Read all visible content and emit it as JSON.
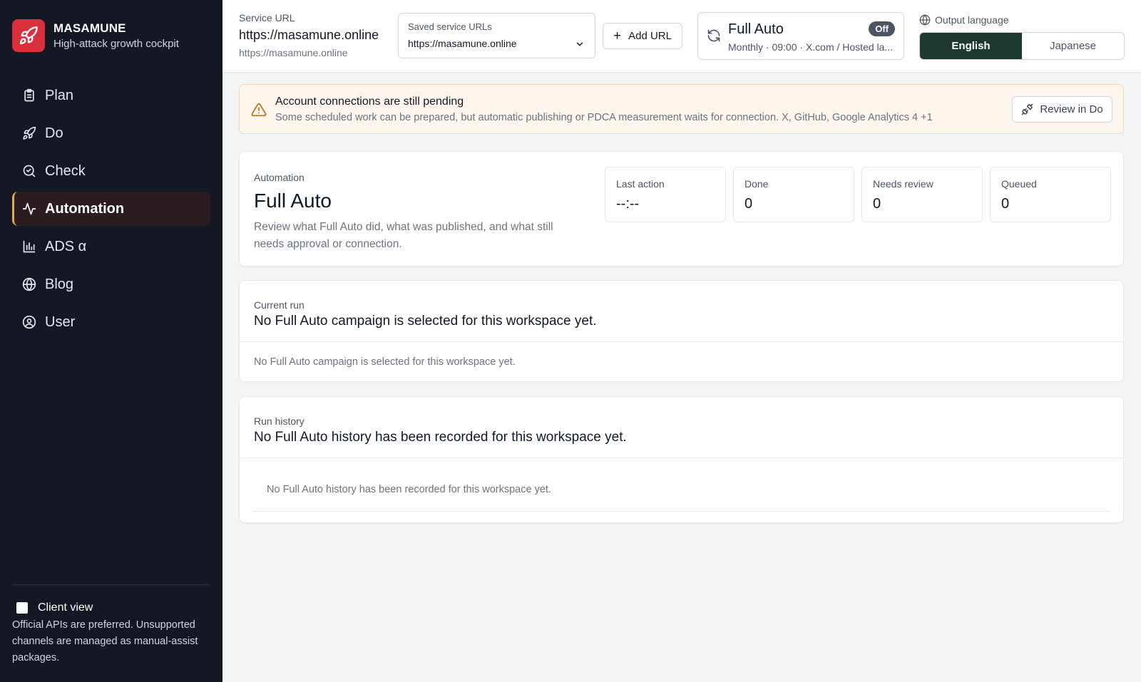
{
  "brand": {
    "name": "MASAMUNE",
    "tagline": "High-attack growth cockpit"
  },
  "nav": [
    {
      "label": "Plan",
      "icon": "clipboard-icon",
      "active": false
    },
    {
      "label": "Do",
      "icon": "rocket-icon",
      "active": false
    },
    {
      "label": "Check",
      "icon": "search-check-icon",
      "active": false
    },
    {
      "label": "Automation",
      "icon": "activity-icon",
      "active": true
    },
    {
      "label": "ADS α",
      "icon": "bar-chart-icon",
      "active": false
    },
    {
      "label": "Blog",
      "icon": "globe-icon",
      "active": false
    },
    {
      "label": "User",
      "icon": "user-circle-icon",
      "active": false
    }
  ],
  "sidebar_footer": {
    "client_view_label": "Client view",
    "client_view_checked": false,
    "note": "Official APIs are preferred. Unsupported channels are managed as manual-assist packages."
  },
  "header": {
    "service_url_label": "Service URL",
    "service_url_value": "https://masamune.online",
    "service_url_sub": "https://masamune.online",
    "saved_label": "Saved service URLs",
    "saved_value": "https://masamune.online",
    "add_url_label": "Add URL",
    "full_auto": {
      "title": "Full Auto",
      "badge": "Off",
      "subtitle": "Monthly · 09:00 · X.com / Hosted la..."
    },
    "language": {
      "label": "Output language",
      "options": [
        "English",
        "Japanese"
      ],
      "selected": "English"
    }
  },
  "alert": {
    "title": "Account connections are still pending",
    "text": "Some scheduled work can be prepared, but automatic publishing or PDCA measurement waits for connection. X, GitHub, Google Analytics 4 +1",
    "button": "Review in Do"
  },
  "automation": {
    "label": "Automation",
    "title": "Full Auto",
    "description": "Review what Full Auto did, what was published, and what still needs approval or connection.",
    "stats": [
      {
        "label": "Last action",
        "value": "--:--"
      },
      {
        "label": "Done",
        "value": "0"
      },
      {
        "label": "Needs review",
        "value": "0"
      },
      {
        "label": "Queued",
        "value": "0"
      }
    ]
  },
  "current_run": {
    "label": "Current run",
    "title": "No Full Auto campaign is selected for this workspace yet.",
    "body": "No Full Auto campaign is selected for this workspace yet."
  },
  "run_history": {
    "label": "Run history",
    "title": "No Full Auto history has been recorded for this workspace yet.",
    "body": "No Full Auto history has been recorded for this workspace yet."
  },
  "colors": {
    "sidebar_bg": "#141824",
    "brand_red": "#dc2f3c",
    "active_accent": "#e5a93a",
    "language_selected": "#1e3a30",
    "alert_bg": "#fef6ec"
  }
}
